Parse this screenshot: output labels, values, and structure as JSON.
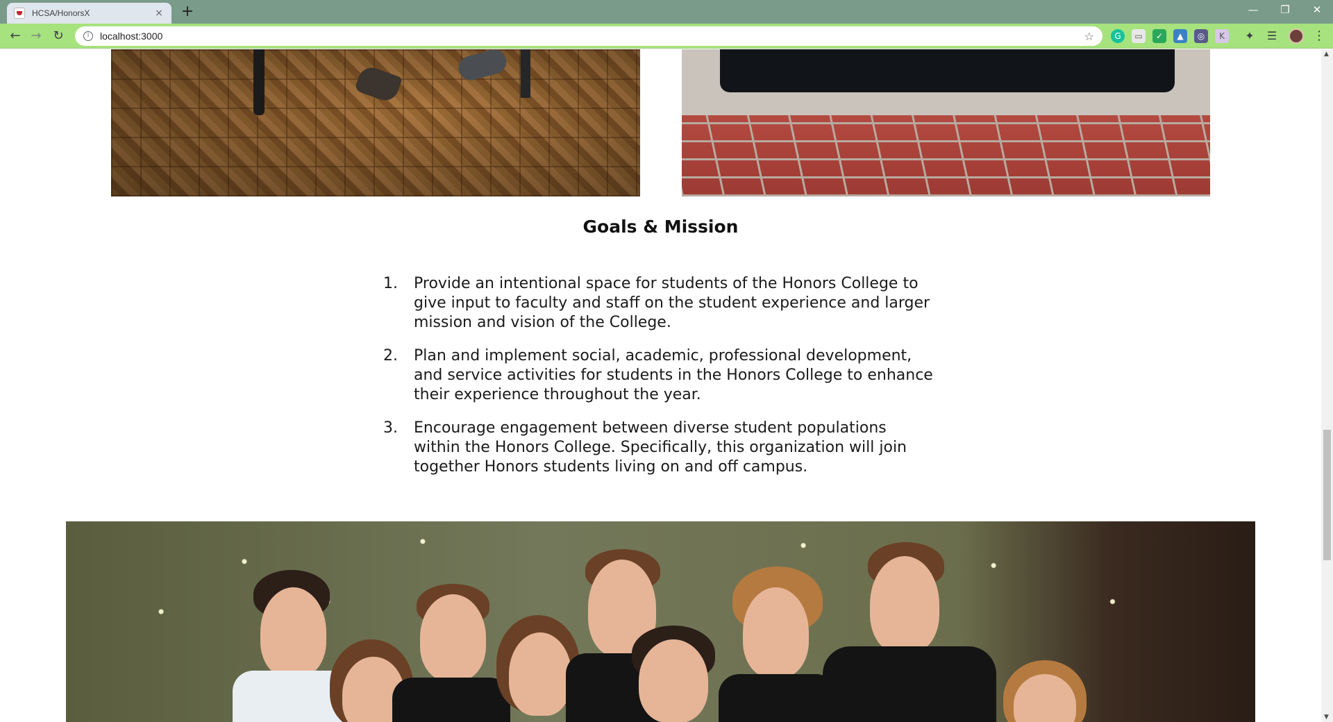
{
  "browser": {
    "tab_title": "HCSA/HonorsX",
    "tab_close": "×",
    "new_tab": "+",
    "url": "localhost:3000",
    "window_controls": {
      "minimize": "—",
      "maximize": "❐",
      "close": "✕"
    },
    "nav": {
      "back": "←",
      "forward": "→",
      "reload": "↻"
    },
    "icons": [
      "info-icon",
      "star-icon",
      "grammarly-icon",
      "extension-icon",
      "shield-icon",
      "drive-icon",
      "extension-icon",
      "extension-icon",
      "puzzle-icon",
      "reading-list-icon",
      "avatar",
      "kebab-menu-icon"
    ]
  },
  "page": {
    "goals_title": "Goals & Mission",
    "goals": [
      {
        "num": "1.",
        "text": "Provide an intentional space for students of the Honors College to give input to faculty and staff on the student experience and larger mission and vision of the College."
      },
      {
        "num": "2.",
        "text": "Plan and implement social, academic, professional development, and service activities for students in the Honors College to enhance their experience throughout the year."
      },
      {
        "num": "3.",
        "text": "Encourage engagement between diverse student populations within the Honors College. Specifically, this organization will join together Honors students living on and off campus."
      }
    ]
  },
  "colors": {
    "tabbar": "#7a9a8a",
    "toolbar": "#a6e27d",
    "text": "#1a1a1a"
  }
}
